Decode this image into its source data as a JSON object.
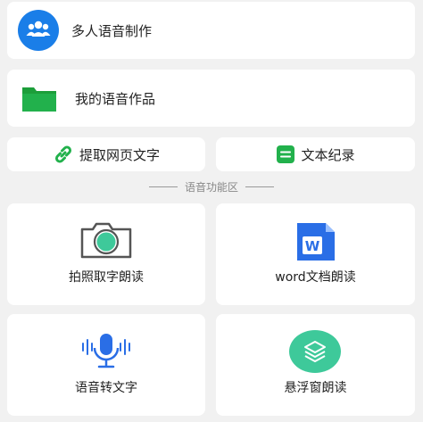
{
  "multi_voice": {
    "label": "多人语音制作",
    "icon": "people-icon"
  },
  "my_works": {
    "label": "我的语音作品",
    "icon": "folder-icon"
  },
  "extract_web": {
    "label": "提取网页文字",
    "icon": "link-icon"
  },
  "text_records": {
    "label": "文本纪录",
    "icon": "note-icon"
  },
  "section_title": "语音功能区",
  "tiles": [
    {
      "label": "拍照取字朗读",
      "icon": "camera-icon"
    },
    {
      "label": "word文档朗读",
      "icon": "word-doc-icon"
    },
    {
      "label": "语音转文字",
      "icon": "microphone-icon"
    },
    {
      "label": "悬浮窗朗读",
      "icon": "layers-icon"
    }
  ],
  "colors": {
    "background": "#f1f1f1",
    "card": "#ffffff",
    "blue": "#1a7ee8",
    "green": "#22b14c",
    "teal": "#3ec99a",
    "word_blue": "#2a6ee6"
  }
}
